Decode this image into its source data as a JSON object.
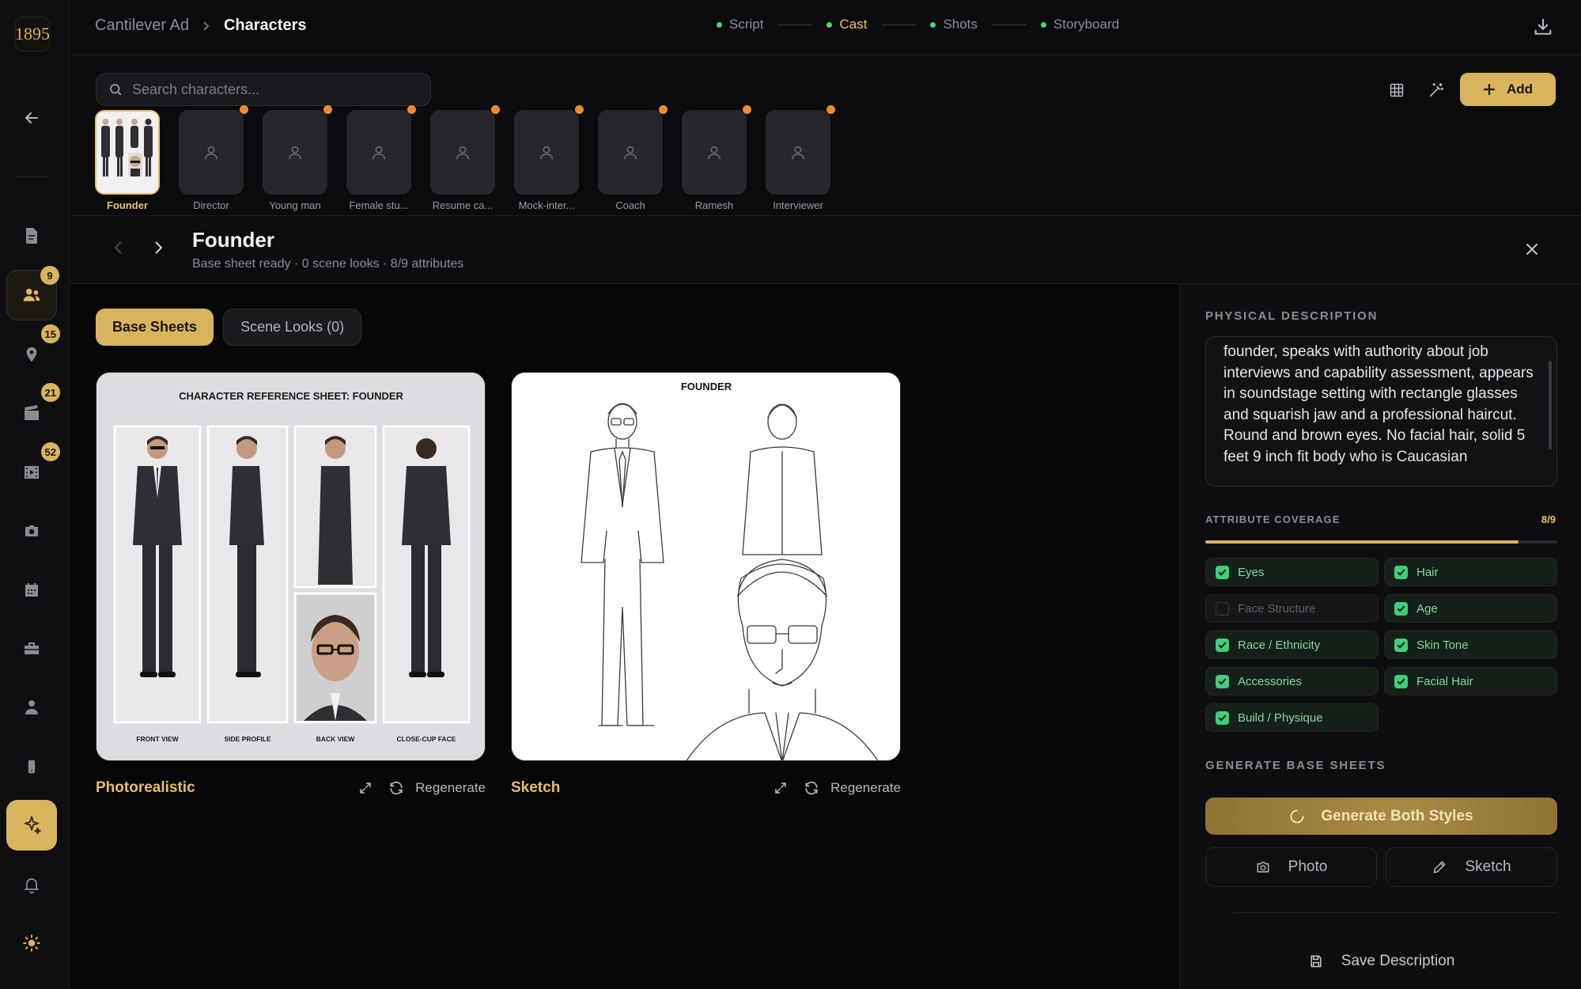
{
  "app": {
    "logo_text": "1895"
  },
  "sidebar": {
    "badges": {
      "cast": "9",
      "locations": "15",
      "scenes": "21",
      "shots": "52"
    }
  },
  "breadcrumb": {
    "project": "Cantilever Ad",
    "separator": ">",
    "current": "Characters"
  },
  "steps": [
    {
      "label": "Script"
    },
    {
      "label": "Cast"
    },
    {
      "label": "Shots"
    },
    {
      "label": "Storyboard"
    }
  ],
  "search": {
    "placeholder": "Search characters..."
  },
  "toolbar": {
    "add_label": "Add"
  },
  "characters": [
    {
      "name": "Founder"
    },
    {
      "name": "Director"
    },
    {
      "name": "Young man"
    },
    {
      "name": "Female stu..."
    },
    {
      "name": "Resume ca..."
    },
    {
      "name": "Mock-inter..."
    },
    {
      "name": "Coach"
    },
    {
      "name": "Ramesh"
    },
    {
      "name": "Interviewer"
    }
  ],
  "detail": {
    "name": "Founder",
    "subtitle": "Base sheet ready · 0 scene looks · 8/9 attributes",
    "tabs": {
      "base": "Base Sheets",
      "scene": "Scene Looks (0)"
    }
  },
  "cards": [
    {
      "style": "Photorealistic",
      "regenerate": "Regenerate",
      "sheet_title": "CHARACTER REFERENCE SHEET: FOUNDER",
      "views": [
        "FRONT VIEW",
        "SIDE PROFILE",
        "BACK VIEW",
        "CLOSE-CUP FACE"
      ]
    },
    {
      "style": "Sketch",
      "regenerate": "Regenerate",
      "sheet_title": "FOUNDER"
    }
  ],
  "panel": {
    "physical_label": "PHYSICAL DESCRIPTION",
    "description": "founder, speaks with authority about job interviews and capability assessment, appears in soundstage setting with rectangle glasses and squarish jaw and a professional haircut. Round and brown eyes. No facial hair, solid 5 feet 9 inch fit body who is Caucasian",
    "coverage_label": "ATTRIBUTE COVERAGE",
    "coverage_value": "8/9",
    "coverage_fraction": 0.889,
    "attributes": [
      {
        "label": "Eyes",
        "checked": true
      },
      {
        "label": "Hair",
        "checked": true
      },
      {
        "label": "Face Structure",
        "checked": false
      },
      {
        "label": "Age",
        "checked": true
      },
      {
        "label": "Race / Ethnicity",
        "checked": true
      },
      {
        "label": "Skin Tone",
        "checked": true
      },
      {
        "label": "Accessories",
        "checked": true
      },
      {
        "label": "Facial Hair",
        "checked": true
      },
      {
        "label": "Build / Physique",
        "checked": true
      }
    ],
    "generate_label": "GENERATE BASE SHEETS",
    "generate_both": "Generate Both Styles",
    "photo": "Photo",
    "sketch": "Sketch",
    "save": "Save Description"
  },
  "colors": {
    "accent": "#d9b45e",
    "accent_text": "#e8c36c",
    "success": "#3fcf7c",
    "notify": "#f08a2c",
    "bg": "#0b0b0d"
  }
}
